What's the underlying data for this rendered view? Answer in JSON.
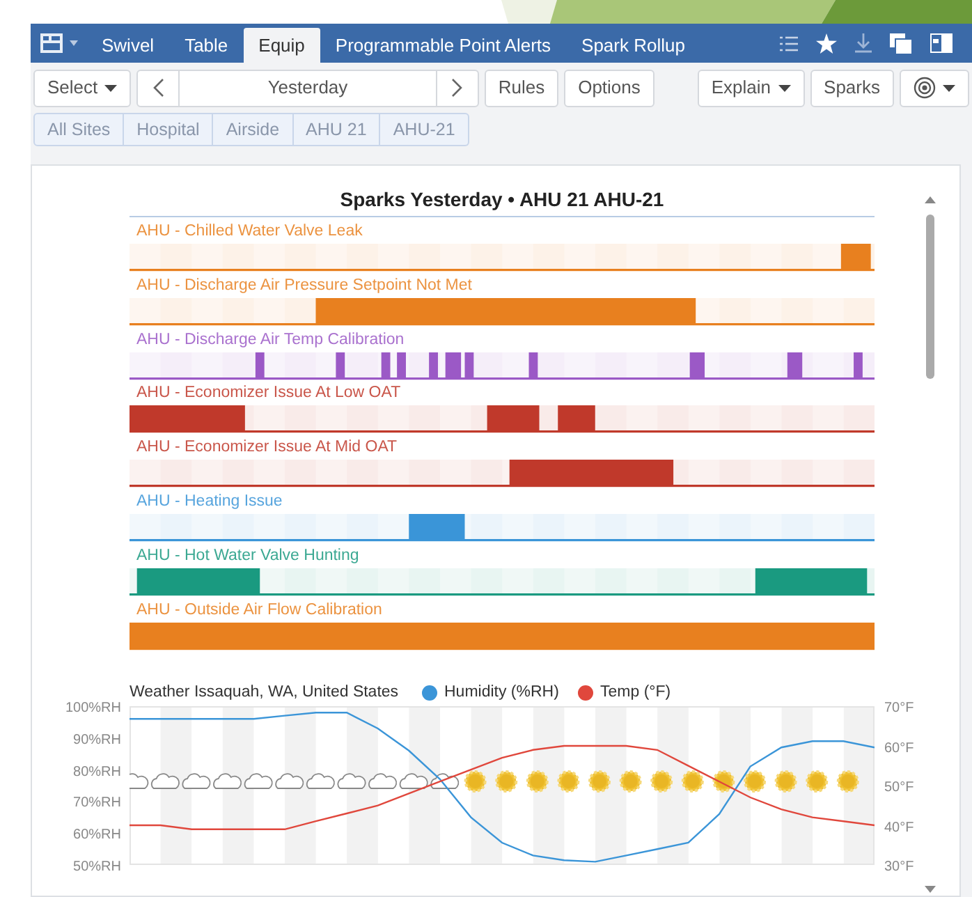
{
  "nav": {
    "tabs": [
      {
        "label": "Swivel",
        "selected": false
      },
      {
        "label": "Table",
        "selected": false
      },
      {
        "label": "Equip",
        "selected": true
      },
      {
        "label": "Programmable Point Alerts",
        "selected": false
      },
      {
        "label": "Spark Rollup",
        "selected": false
      }
    ]
  },
  "toolbar": {
    "select": "Select",
    "date": "Yesterday",
    "rules": "Rules",
    "options": "Options",
    "explain": "Explain",
    "sparks": "Sparks"
  },
  "breadcrumbs": [
    "All Sites",
    "Hospital",
    "Airside",
    "AHU 21",
    "AHU-21"
  ],
  "sparks": {
    "title": "Sparks Yesterday • AHU 21 AHU-21",
    "rows": [
      {
        "label": "AHU - Chilled Water Valve Leak",
        "color": "#e8801f"
      },
      {
        "label": "AHU - Discharge Air Pressure Setpoint Not Met",
        "color": "#e8801f"
      },
      {
        "label": "AHU - Discharge Air Temp Calibration",
        "color": "#9b59c6"
      },
      {
        "label": "AHU - Economizer Issue At Low OAT",
        "color": "#c0392b"
      },
      {
        "label": "AHU - Economizer Issue At Mid OAT",
        "color": "#c0392b"
      },
      {
        "label": "AHU - Heating Issue",
        "color": "#3a95d8"
      },
      {
        "label": "AHU - Hot Water Valve Hunting",
        "color": "#1a9a80"
      },
      {
        "label": "AHU - Outside Air Flow Calibration",
        "color": "#e8801f"
      }
    ]
  },
  "weather": {
    "humidity": {
      "chart_data": {
        "type": "line",
        "title": "Weather Issaquah, WA, United States",
        "legend": "top",
        "ylim": [
          50,
          100
        ],
        "yticks": [
          {
            "value": 100,
            "label": "100%RH"
          },
          {
            "value": 90,
            "label": "90%RH"
          },
          {
            "value": 80,
            "label": "80%RH"
          },
          {
            "value": 70,
            "label": "70%RH"
          },
          {
            "value": 60,
            "label": "60%RH"
          },
          {
            "value": 50,
            "label": "50%RH"
          }
        ],
        "series": [
          {
            "name": "Humidity (%RH)",
            "color": "#3b95d8",
            "values": [
              96,
              96,
              96,
              96,
              96,
              97,
              98,
              98,
              93,
              86,
              77,
              65,
              57,
              53,
              51.5,
              51,
              53,
              55,
              57,
              66,
              81,
              87,
              89,
              89,
              87
            ]
          }
        ]
      }
    },
    "temp": {
      "chart_data": {
        "type": "line",
        "legend": "top",
        "ylim": [
          30,
          70
        ],
        "yticks": [
          {
            "value": 70,
            "label": "70°F"
          },
          {
            "value": 60,
            "label": "60°F"
          },
          {
            "value": 50,
            "label": "50°F"
          },
          {
            "value": 40,
            "label": "40°F"
          },
          {
            "value": 30,
            "label": "30°F"
          }
        ],
        "series": [
          {
            "name": "Temp (°F)",
            "color": "#e0473c",
            "values": [
              40,
              40,
              39,
              39,
              39,
              39,
              41,
              43,
              45,
              48,
              51,
              54,
              57,
              59,
              60,
              60,
              60,
              59,
              55,
              51,
              47,
              44,
              42,
              41,
              40
            ]
          }
        ]
      }
    }
  }
}
